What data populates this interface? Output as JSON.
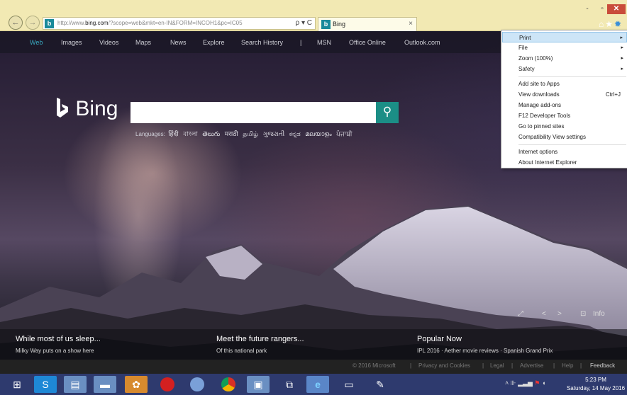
{
  "window": {
    "minimize": "-",
    "maximize": "▫",
    "close": "✕"
  },
  "addressbar": {
    "url_prefix": "http://www.",
    "url_domain": "bing.com",
    "url_rest": "/?scope=web&mkt=en-IN&FORM=INCOH1&pc=IC05",
    "tools": "ρ ▾ C"
  },
  "tab": {
    "title": "Bing",
    "close": "×"
  },
  "topnav": {
    "items": [
      "Web",
      "Images",
      "Videos",
      "Maps",
      "News",
      "Explore",
      "Search History",
      "|",
      "MSN",
      "Office Online",
      "Outlook.com"
    ]
  },
  "logo": {
    "text": "Bing"
  },
  "search": {
    "placeholder": "",
    "button_glyph": "⚲"
  },
  "languages": {
    "label": "Languages:",
    "items": [
      "हिंदी",
      "বাংলা",
      "తెలుగు",
      "मराठी",
      "தமிழ்",
      "ગુજરાતી",
      "ಕನ್ನಡ",
      "മലയാളം",
      "ਪੰਜਾਬੀ"
    ]
  },
  "media": {
    "expand": "⤢",
    "prev": "<",
    "next": ">",
    "camera": "⊡",
    "info": "Info"
  },
  "stories": [
    {
      "headline": "While most of us sleep...",
      "sub": "Milky Way puts on a show here"
    },
    {
      "headline": "Meet the future rangers...",
      "sub": "Of this national park"
    },
    {
      "headline": "Popular Now",
      "sub": "IPL 2016 · Aether movie reviews · Spanish Grand Prix"
    }
  ],
  "footer": {
    "copyright": "© 2016 Microsoft",
    "privacy": "Privacy and Cookies",
    "legal": "Legal",
    "advertise": "Advertise",
    "help": "Help",
    "feedback": "Feedback"
  },
  "menu": {
    "items": [
      {
        "label": "Print",
        "arrow": "▸"
      },
      {
        "label": "File",
        "arrow": "▸"
      },
      {
        "label": "Zoom (100%)",
        "arrow": "▸"
      },
      {
        "label": "Safety",
        "arrow": "▸"
      },
      {
        "label": "Add site to Apps"
      },
      {
        "label": "View downloads",
        "shortcut": "Ctrl+J"
      },
      {
        "label": "Manage add-ons"
      },
      {
        "label": "F12 Developer Tools"
      },
      {
        "label": "Go to pinned sites"
      },
      {
        "label": "Compatibility View settings"
      },
      {
        "label": "Internet options"
      },
      {
        "label": "About Internet Explorer"
      }
    ]
  },
  "taskbar": {
    "clock_time": "5:23 PM",
    "clock_date": "Saturday, 14 May 2016"
  },
  "colors": {
    "search_button": "#1b8e86",
    "menu_highlight": "#cde5f7",
    "close_button": "#c94c3a",
    "taskbar": "#2e3a6e"
  }
}
